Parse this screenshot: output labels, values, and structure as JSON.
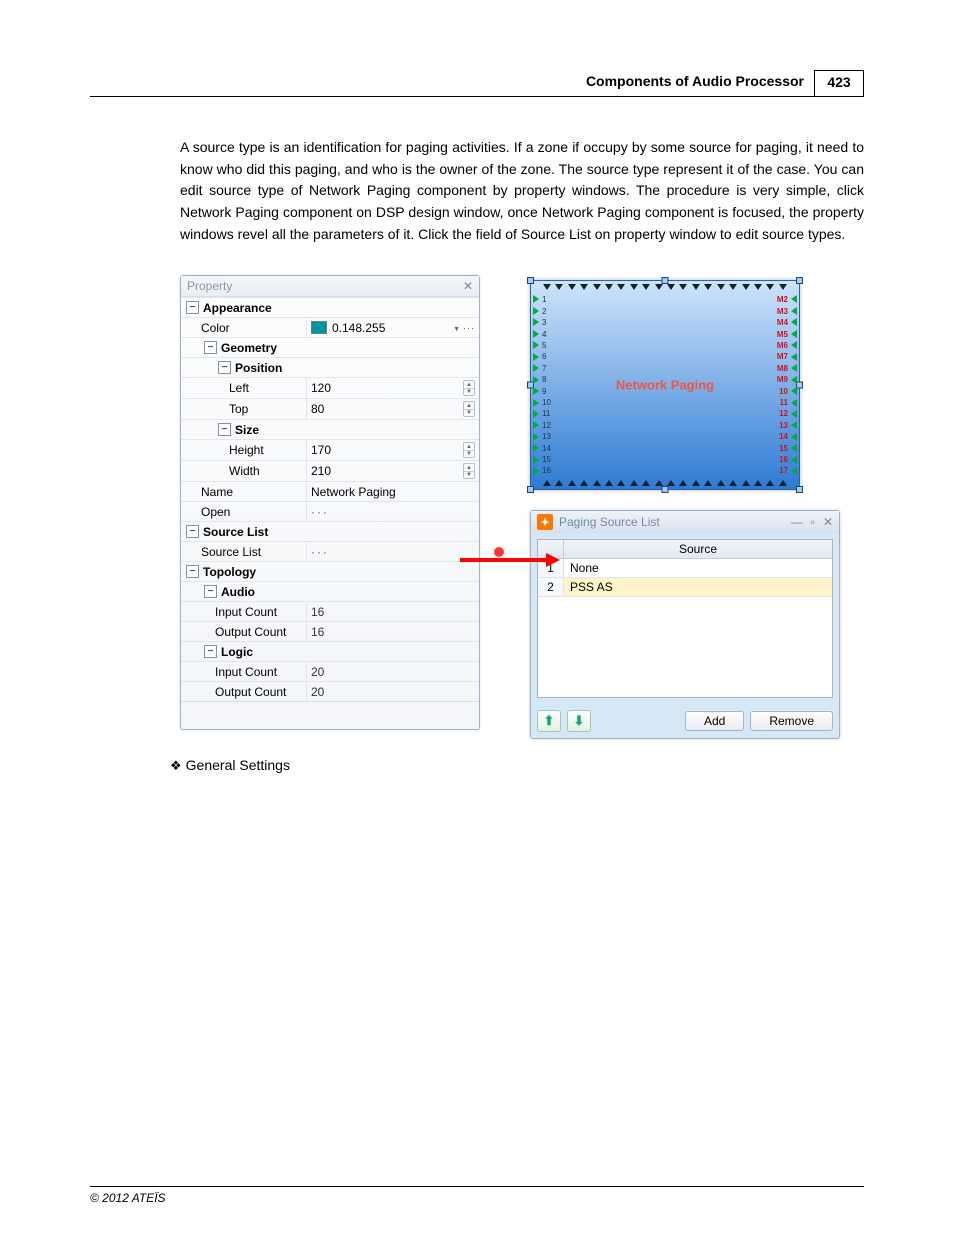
{
  "header": {
    "title": "Components of Audio Processor",
    "page": "423"
  },
  "paragraph": "A source type is an identification for paging activities. If a zone if occupy by some source for paging, it need to know who did this paging, and who is the owner of the zone. The source type represent it of the case. You can edit source type of Network Paging component by property windows. The procedure is very simple, click Network Paging component on DSP design window, once Network Paging component is focused, the property windows revel all the parameters of it. Click the field of Source List on property window to edit source types.",
  "property_panel": {
    "title": "Property",
    "sections": {
      "appearance": "Appearance",
      "color_label": "Color",
      "color_value": "0.148.255",
      "geometry": "Geometry",
      "position": "Position",
      "left_label": "Left",
      "left_value": "120",
      "top_label": "Top",
      "top_value": "80",
      "size": "Size",
      "height_label": "Height",
      "height_value": "170",
      "width_label": "Width",
      "width_value": "210",
      "name_label": "Name",
      "name_value": "Network Paging",
      "open_label": "Open",
      "sourcelist_section": "Source List",
      "sourcelist_label": "Source List",
      "topology": "Topology",
      "audio": "Audio",
      "audio_in_label": "Input Count",
      "audio_in_value": "16",
      "audio_out_label": "Output Count",
      "audio_out_value": "16",
      "logic": "Logic",
      "logic_in_label": "Input Count",
      "logic_in_value": "20",
      "logic_out_label": "Output Count",
      "logic_out_value": "20"
    }
  },
  "dsp_component": {
    "label": "Network Paging"
  },
  "paging_dialog": {
    "title": "Paging Source List",
    "column_header": "Source",
    "rows": [
      {
        "n": "1",
        "label": "None"
      },
      {
        "n": "2",
        "label": "PSS AS"
      }
    ],
    "add_btn": "Add",
    "remove_btn": "Remove"
  },
  "subheading": "General Settings",
  "footer": "© 2012 ATEÏS"
}
